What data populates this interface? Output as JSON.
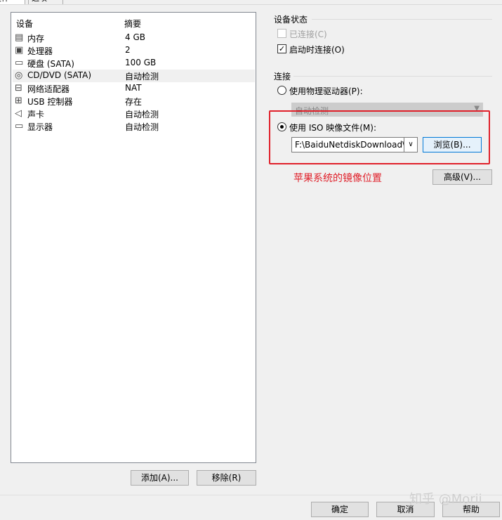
{
  "tabs": [
    "硬件",
    "选项"
  ],
  "device_list": {
    "col_device": "设备",
    "col_summary": "摘要",
    "rows": [
      {
        "name": "内存",
        "summary": "4 GB",
        "icon": "memory-icon"
      },
      {
        "name": "处理器",
        "summary": "2",
        "icon": "processor-icon"
      },
      {
        "name": "硬盘 (SATA)",
        "summary": "100 GB",
        "icon": "harddisk-icon"
      },
      {
        "name": "CD/DVD (SATA)",
        "summary": "自动检测",
        "icon": "cd-icon"
      },
      {
        "name": "网络适配器",
        "summary": "NAT",
        "icon": "network-icon"
      },
      {
        "name": "USB 控制器",
        "summary": "存在",
        "icon": "usb-icon"
      },
      {
        "name": "声卡",
        "summary": "自动检测",
        "icon": "speaker-icon"
      },
      {
        "name": "显示器",
        "summary": "自动检测",
        "icon": "monitor-icon"
      }
    ]
  },
  "buttons": {
    "add": "添加(A)...",
    "remove": "移除(R)",
    "browse": "浏览(B)...",
    "advanced": "高级(V)...",
    "ok": "确定",
    "cancel": "取消",
    "help": "帮助"
  },
  "device_status": {
    "title": "设备状态",
    "connected": "已连接(C)",
    "connect_on_start": "启动时连接(O)"
  },
  "connection": {
    "title": "连接",
    "physical_drive": "使用物理驱动器(P):",
    "physical_drive_value": "自动检测",
    "iso_image": "使用 ISO 映像文件(M):",
    "iso_path": "F:\\BaiduNetdiskDownload\\In"
  },
  "annotation": "苹果系统的镜像位置",
  "watermark": "知乎 @Morii"
}
